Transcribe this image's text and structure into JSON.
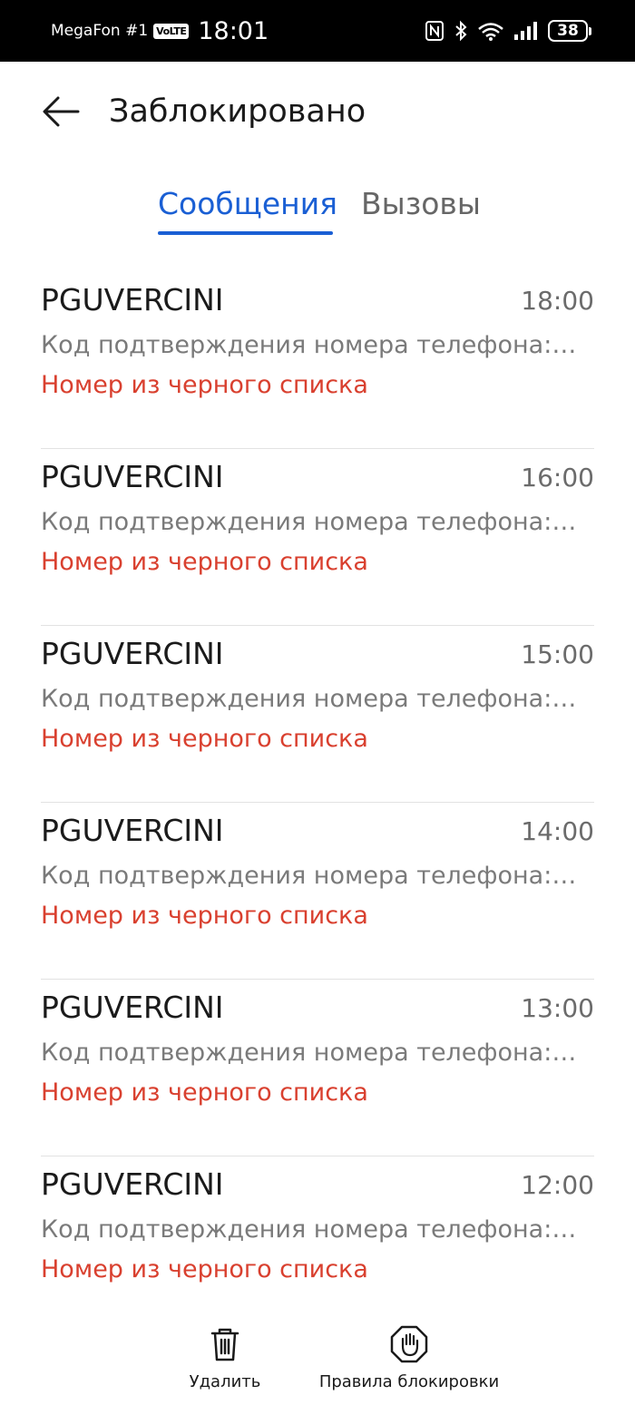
{
  "status_bar": {
    "carrier": "MegaFon #1",
    "volte": "VoLTE",
    "time": "18:01",
    "battery": "38",
    "icons": [
      "nfc-icon",
      "bluetooth-icon",
      "wifi-6-icon",
      "signal-icon",
      "battery-icon"
    ]
  },
  "header": {
    "title": "Заблокировано",
    "back_icon": "arrow-left-icon"
  },
  "tabs": [
    {
      "label": "Сообщения",
      "active": true
    },
    {
      "label": "Вызовы",
      "active": false
    }
  ],
  "messages": [
    {
      "sender": "PGUVERCINI",
      "time": "18:00",
      "preview": "Код подтверждения номера телефона:…",
      "status": "Номер из черного списка"
    },
    {
      "sender": "PGUVERCINI",
      "time": "16:00",
      "preview": "Код подтверждения номера телефона:…",
      "status": "Номер из черного списка"
    },
    {
      "sender": "PGUVERCINI",
      "time": "15:00",
      "preview": "Код подтверждения номера телефона:…",
      "status": "Номер из черного списка"
    },
    {
      "sender": "PGUVERCINI",
      "time": "14:00",
      "preview": "Код подтверждения номера телефона:…",
      "status": "Номер из черного списка"
    },
    {
      "sender": "PGUVERCINI",
      "time": "13:00",
      "preview": "Код подтверждения номера телефона:…",
      "status": "Номер из черного списка"
    },
    {
      "sender": "PGUVERCINI",
      "time": "12:00",
      "preview": "Код подтверждения номера телефона:…",
      "status": "Номер из черного списка"
    }
  ],
  "bottom_bar": {
    "delete_label": "Удалить",
    "delete_icon": "trash-icon",
    "rules_label": "Правила блокировки",
    "rules_icon": "hand-stop-icon"
  },
  "colors": {
    "accent": "#1a5fd4",
    "blocked_status": "#d9402f",
    "status_bar_bg": "#000000"
  }
}
